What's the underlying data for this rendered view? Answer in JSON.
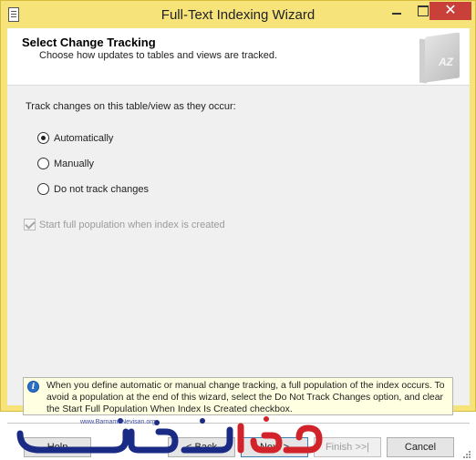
{
  "window": {
    "title": "Full-Text Indexing Wizard"
  },
  "header": {
    "title": "Select Change Tracking",
    "subtitle": "Choose how updates to tables and views are tracked.",
    "graphic_label": "AZ"
  },
  "content": {
    "prompt": "Track changes on this table/view as they occur:",
    "options": [
      {
        "label": "Automatically",
        "selected": true
      },
      {
        "label": "Manually",
        "selected": false
      },
      {
        "label": "Do not track changes",
        "selected": false
      }
    ],
    "checkbox": {
      "label": "Start full population when index is created",
      "checked": true,
      "enabled": false
    },
    "info_text": "When you define automatic or manual change tracking, a full population of the index occurs. To avoid a population at the end of this wizard, select the Do Not Track Changes option, and clear the Start Full Population When Index Is Created checkbox."
  },
  "buttons": {
    "help": "Help",
    "back": "< Back",
    "next": "Next >",
    "finish": "Finish >>|",
    "cancel": "Cancel"
  },
  "watermark": {
    "url": "www.BarnameNevisan.org",
    "brand_color": "#1a2b86",
    "accent_color": "#d2232a"
  },
  "colors": {
    "titlebar": "#f6e37a",
    "close_button": "#c9403a",
    "info_background": "#ffffe1"
  }
}
